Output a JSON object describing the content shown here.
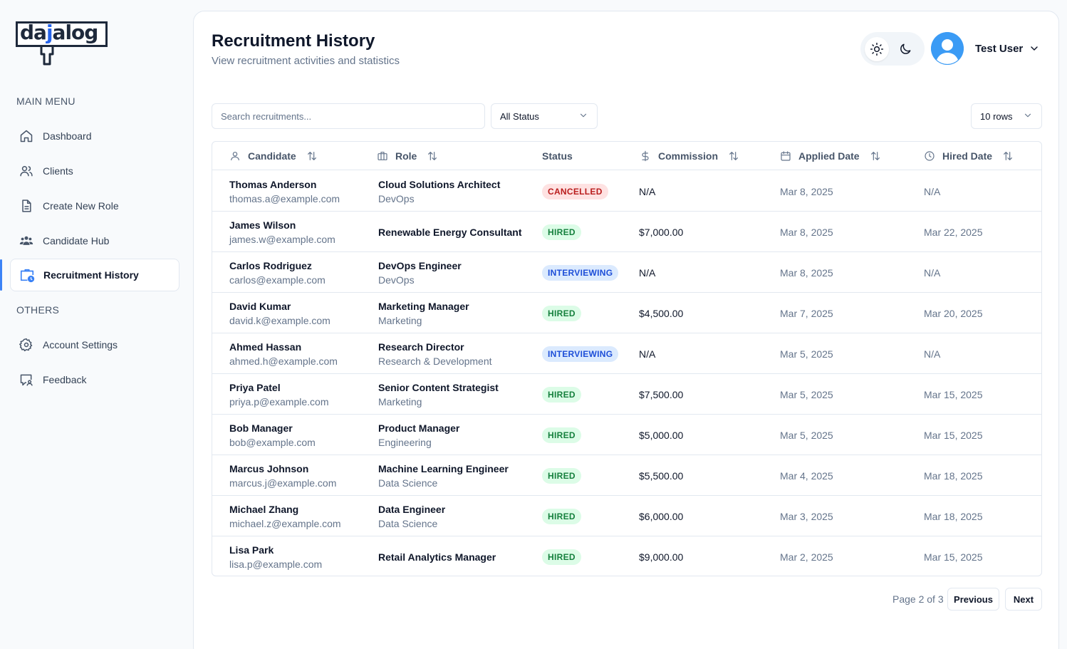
{
  "brand": {
    "logo_text_pre": "da",
    "logo_text_j": "j",
    "logo_text_post": "alog"
  },
  "sidebar": {
    "main_menu_label": "MAIN MENU",
    "others_label": "OTHERS",
    "items": [
      {
        "label": "Dashboard",
        "icon": "home-icon"
      },
      {
        "label": "Clients",
        "icon": "users-icon"
      },
      {
        "label": "Create New Role",
        "icon": "document-icon"
      },
      {
        "label": "Candidate Hub",
        "icon": "group-icon"
      },
      {
        "label": "Recruitment History",
        "icon": "briefcase-clock-icon",
        "active": true
      },
      {
        "label": "Account Settings",
        "icon": "gear-icon"
      },
      {
        "label": "Feedback",
        "icon": "feedback-icon"
      }
    ]
  },
  "header": {
    "title": "Recruitment History",
    "subtitle": "View recruitment activities and statistics",
    "user_name": "Test User"
  },
  "filters": {
    "search_placeholder": "Search recruitments...",
    "status_value": "All Status",
    "rows_value": "10 rows"
  },
  "table": {
    "columns": [
      "Candidate",
      "Role",
      "Status",
      "Commission",
      "Applied Date",
      "Hired Date"
    ],
    "rows": [
      {
        "name": "Thomas Anderson",
        "email": "thomas.a@example.com",
        "role": "Cloud Solutions Architect",
        "dept": "DevOps",
        "status": "CANCELLED",
        "commission": "N/A",
        "applied": "Mar 8, 2025",
        "hired": "N/A"
      },
      {
        "name": "James Wilson",
        "email": "james.w@example.com",
        "role": "Renewable Energy Consultant",
        "dept": "",
        "status": "HIRED",
        "commission": "$7,000.00",
        "applied": "Mar 8, 2025",
        "hired": "Mar 22, 2025"
      },
      {
        "name": "Carlos Rodriguez",
        "email": "carlos@example.com",
        "role": "DevOps Engineer",
        "dept": "DevOps",
        "status": "INTERVIEWING",
        "commission": "N/A",
        "applied": "Mar 8, 2025",
        "hired": "N/A"
      },
      {
        "name": "David Kumar",
        "email": "david.k@example.com",
        "role": "Marketing Manager",
        "dept": "Marketing",
        "status": "HIRED",
        "commission": "$4,500.00",
        "applied": "Mar 7, 2025",
        "hired": "Mar 20, 2025"
      },
      {
        "name": "Ahmed Hassan",
        "email": "ahmed.h@example.com",
        "role": "Research Director",
        "dept": "Research & Development",
        "status": "INTERVIEWING",
        "commission": "N/A",
        "applied": "Mar 5, 2025",
        "hired": "N/A"
      },
      {
        "name": "Priya Patel",
        "email": "priya.p@example.com",
        "role": "Senior Content Strategist",
        "dept": "Marketing",
        "status": "HIRED",
        "commission": "$7,500.00",
        "applied": "Mar 5, 2025",
        "hired": "Mar 15, 2025"
      },
      {
        "name": "Bob Manager",
        "email": "bob@example.com",
        "role": "Product Manager",
        "dept": "Engineering",
        "status": "HIRED",
        "commission": "$5,000.00",
        "applied": "Mar 5, 2025",
        "hired": "Mar 15, 2025"
      },
      {
        "name": "Marcus Johnson",
        "email": "marcus.j@example.com",
        "role": "Machine Learning Engineer",
        "dept": "Data Science",
        "status": "HIRED",
        "commission": "$5,500.00",
        "applied": "Mar 4, 2025",
        "hired": "Mar 18, 2025"
      },
      {
        "name": "Michael Zhang",
        "email": "michael.z@example.com",
        "role": "Data Engineer",
        "dept": "Data Science",
        "status": "HIRED",
        "commission": "$6,000.00",
        "applied": "Mar 3, 2025",
        "hired": "Mar 18, 2025"
      },
      {
        "name": "Lisa Park",
        "email": "lisa.p@example.com",
        "role": "Retail Analytics Manager",
        "dept": "",
        "status": "HIRED",
        "commission": "$9,000.00",
        "applied": "Mar 2, 2025",
        "hired": "Mar 15, 2025"
      }
    ]
  },
  "pagination": {
    "info": "Page 2 of 3",
    "previous": "Previous",
    "next": "Next"
  },
  "colors": {
    "accent": "#3b82f6",
    "cancelled": "#b91c1c",
    "hired": "#15803d",
    "interviewing": "#1d4ed8"
  }
}
